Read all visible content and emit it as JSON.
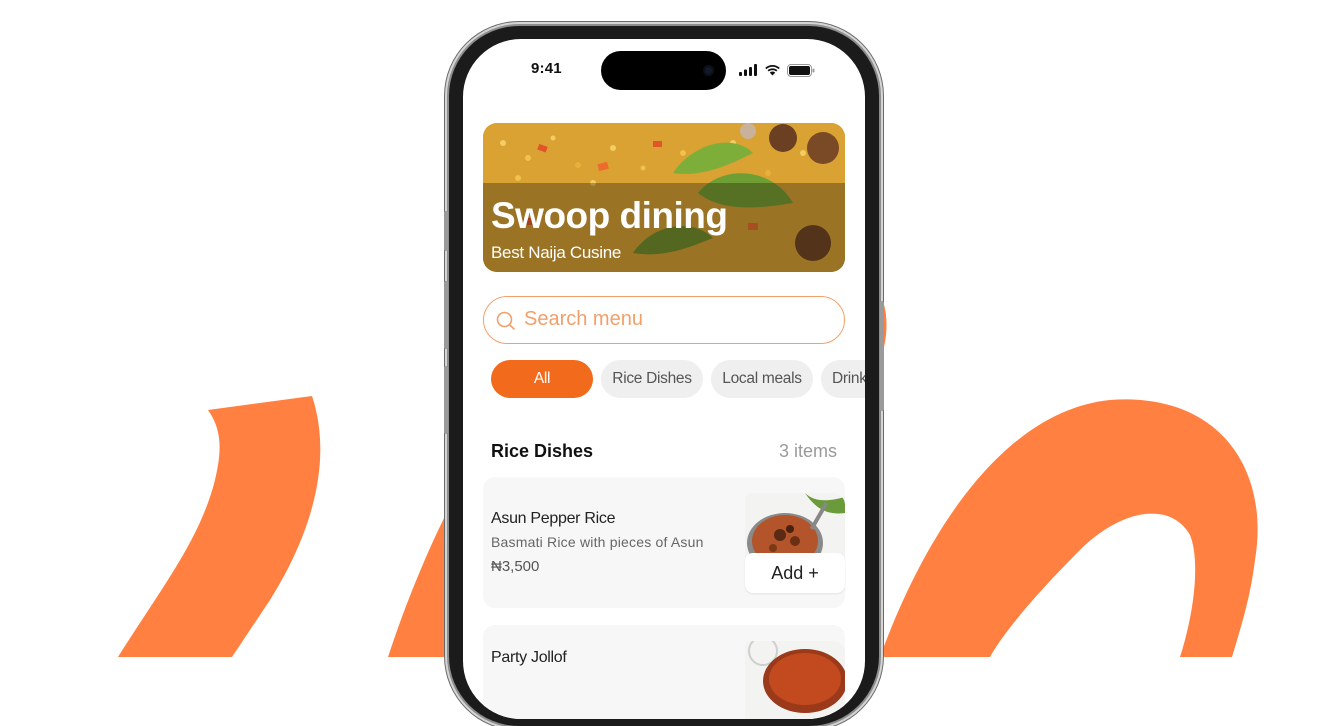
{
  "status": {
    "time": "9:41"
  },
  "hero": {
    "title": "Swoop dining",
    "subtitle": "Best Naija Cusine"
  },
  "search": {
    "placeholder": "Search menu"
  },
  "filters": [
    {
      "label": "All",
      "active": true
    },
    {
      "label": "Rice Dishes",
      "active": false
    },
    {
      "label": "Local meals",
      "active": false
    },
    {
      "label": "Drinks",
      "active": false
    }
  ],
  "section": {
    "title": "Rice Dishes",
    "count": "3 items"
  },
  "items": [
    {
      "name": "Asun Pepper Rice",
      "description": "Basmati Rice with pieces of Asun",
      "price": "₦3,500",
      "add_label": "Add +"
    },
    {
      "name": "Party Jollof",
      "description": "",
      "price": "",
      "add_label": ""
    }
  ],
  "colors": {
    "accent": "#f26b1d",
    "background_swirl": "#ff8040",
    "search_border": "#f2a06a"
  }
}
